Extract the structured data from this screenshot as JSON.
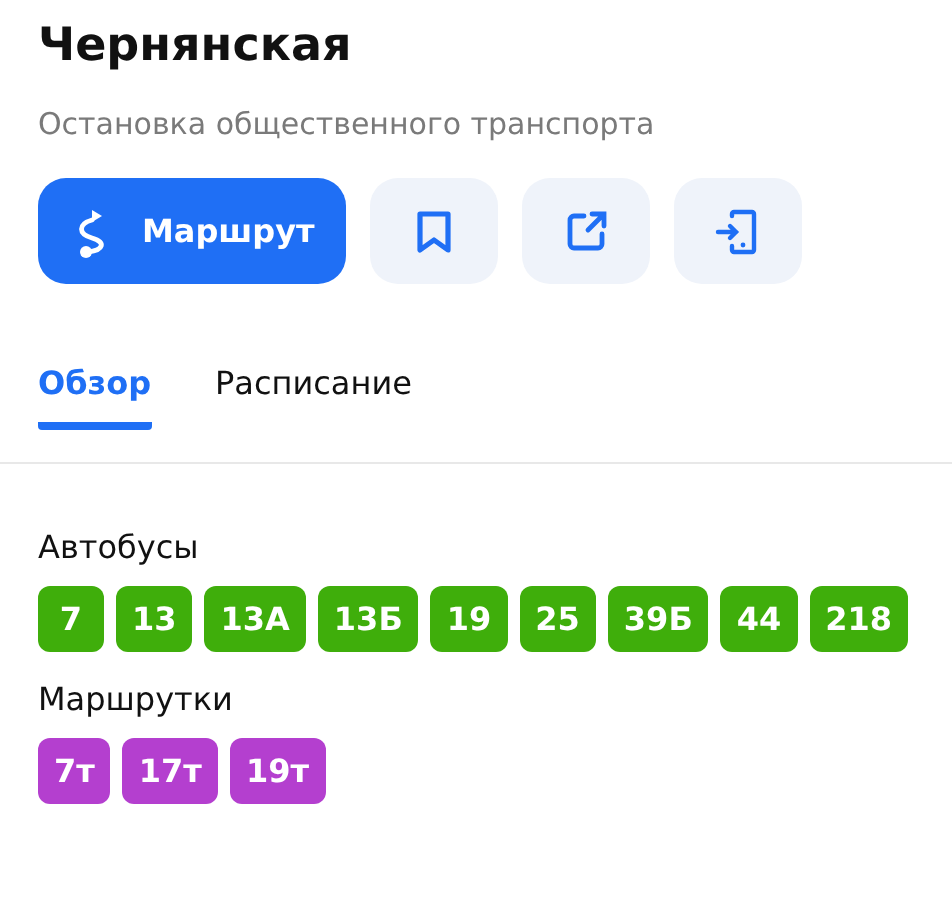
{
  "title": "Чернянская",
  "subtitle": "Остановка общественного транспорта",
  "route_button": {
    "label": "Маршрут"
  },
  "actions": [
    {
      "kind": "bookmark"
    },
    {
      "kind": "share"
    },
    {
      "kind": "phone"
    }
  ],
  "tabs": [
    {
      "label": "Обзор",
      "selected": true
    },
    {
      "label": "Расписание",
      "selected": false
    }
  ],
  "groups": [
    {
      "heading": "Автобусы",
      "color": "#3fae0b",
      "routes": [
        "7",
        "13",
        "13А",
        "13Б",
        "19",
        "25",
        "39Б",
        "44",
        "218"
      ]
    },
    {
      "heading": "Маршрутки",
      "color": "#b43fcf",
      "routes": [
        "7т",
        "17т",
        "19т"
      ]
    }
  ]
}
